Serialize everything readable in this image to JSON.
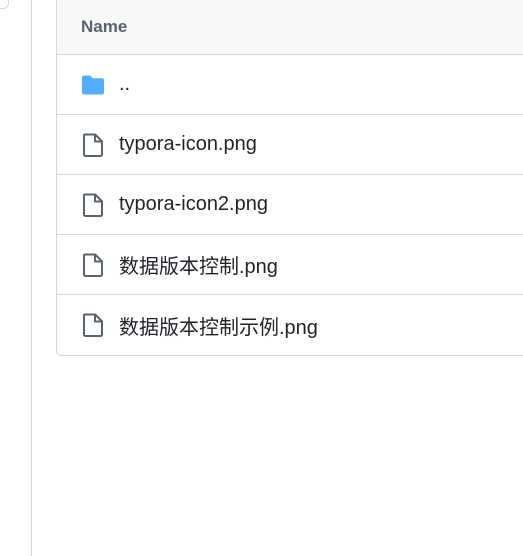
{
  "table": {
    "header_label": "Name",
    "rows": [
      {
        "label": "..",
        "icon": "folder-icon"
      },
      {
        "label": "typora-icon.png",
        "icon": "file-icon"
      },
      {
        "label": "typora-icon2.png",
        "icon": "file-icon"
      },
      {
        "label": "数据版本控制.png",
        "icon": "file-icon"
      },
      {
        "label": "数据版本控制示例.png",
        "icon": "file-icon"
      }
    ]
  },
  "colors": {
    "folder": "#54aeff",
    "file_icon": "#59636e",
    "border": "#d0d7de",
    "header_bg": "#f6f8fa"
  }
}
